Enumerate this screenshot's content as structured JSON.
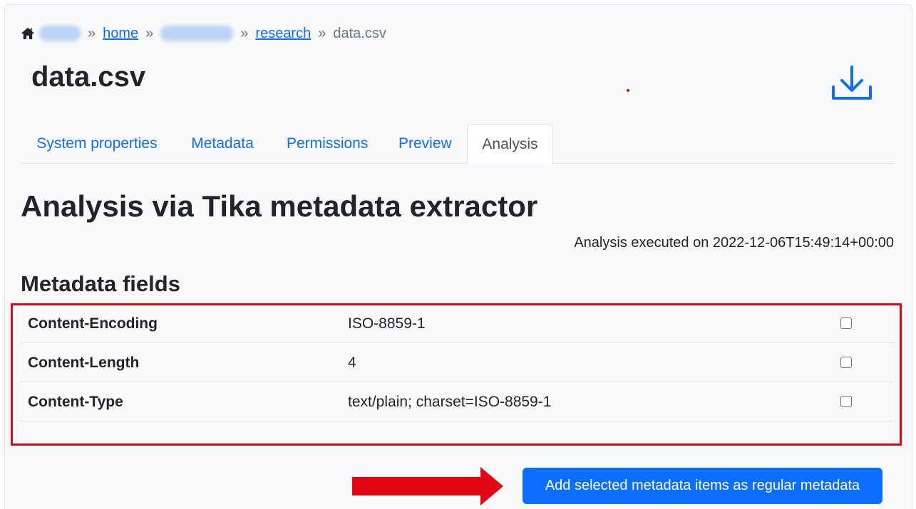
{
  "breadcrumb": {
    "home_link": "home",
    "research_link": "research",
    "current": "data.csv",
    "separator": "»"
  },
  "file_title": "data.csv",
  "tabs": [
    {
      "label": "System properties"
    },
    {
      "label": "Metadata"
    },
    {
      "label": "Permissions"
    },
    {
      "label": "Preview"
    },
    {
      "label": "Analysis",
      "active": true
    }
  ],
  "analysis": {
    "title": "Analysis via Tika metadata extractor",
    "executed": "Analysis executed on 2022-12-06T15:49:14+00:00",
    "fields_title": "Metadata fields",
    "rows": [
      {
        "key": "Content-Encoding",
        "value": "ISO-8859-1",
        "checked": false
      },
      {
        "key": "Content-Length",
        "value": "4",
        "checked": false
      },
      {
        "key": "Content-Type",
        "value": "text/plain; charset=ISO-8859-1",
        "checked": false
      }
    ],
    "add_button": "Add selected metadata items as regular metadata"
  },
  "colors": {
    "primary": "#0d6efd",
    "highlight": "#e30613"
  },
  "icons": [
    "home-icon",
    "download-icon",
    "arrow-right-icon"
  ]
}
